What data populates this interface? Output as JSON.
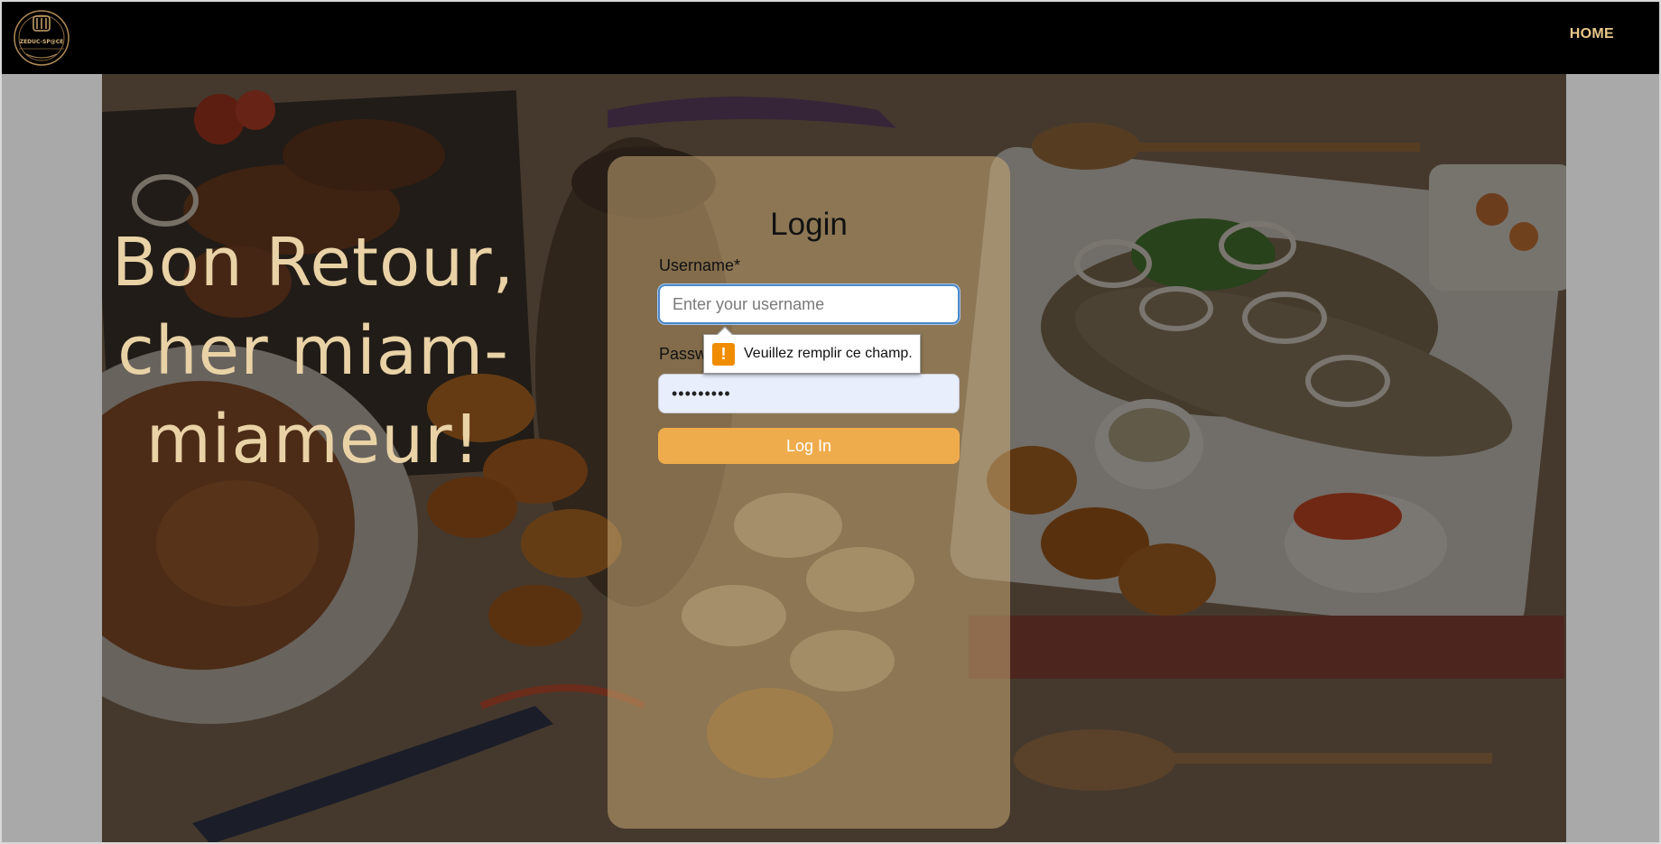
{
  "navbar": {
    "logo_text": "ZEDUC-SP@CE",
    "home_label": "HOME"
  },
  "hero": {
    "headline_lines": [
      "Bon Retour,",
      "cher miam-",
      "miameur!"
    ]
  },
  "login_form": {
    "title": "Login",
    "username_label": "Username*",
    "username_placeholder": "Enter your username",
    "username_value": "",
    "password_label": "Password*",
    "password_value": "•••••••••",
    "submit_label": "Log In"
  },
  "validation_tooltip": {
    "message": "Veuillez remplir ce champ.",
    "icon": "warning-icon"
  },
  "colors": {
    "nav_bg": "#000000",
    "nav_link": "#e8c88a",
    "headline": "#e9d2a6",
    "button": "#efac4c",
    "card": "#cdaf78"
  }
}
